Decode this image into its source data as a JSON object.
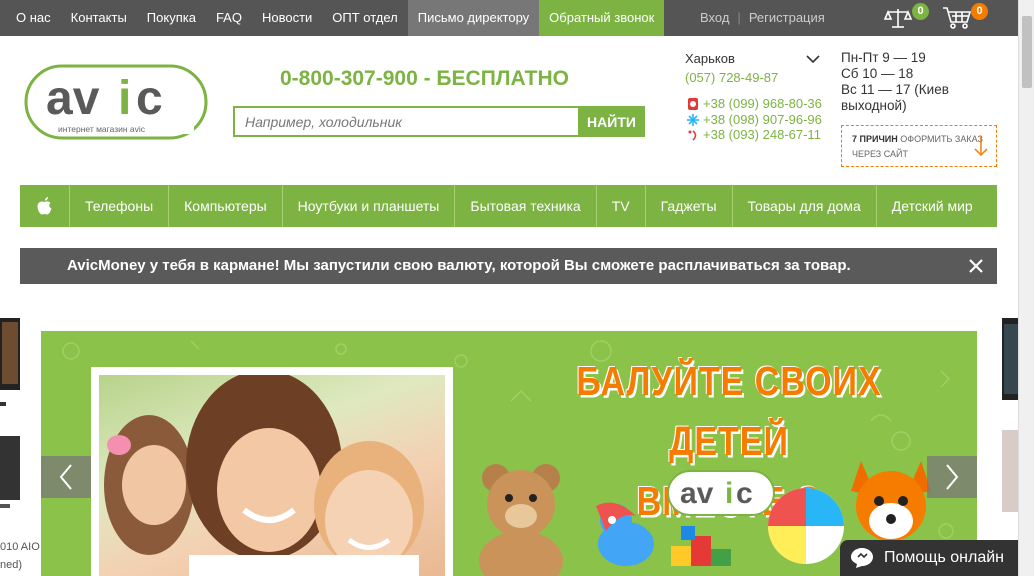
{
  "topbar": {
    "links": [
      "О нас",
      "Контакты",
      "Покупка",
      "FAQ",
      "Новости",
      "ОПТ отдел"
    ],
    "director_label": "Письмо директору",
    "callback_label": "Обратный звонок",
    "login_label": "Вход",
    "auth_separator": "|",
    "register_label": "Регистрация",
    "compare_count": "0",
    "cart_count": "0"
  },
  "header": {
    "logo_text": "avic",
    "logo_subtitle": "интернет магазин avic",
    "main_phone": "0-800-307-900 - БЕСПЛАТНО",
    "search_placeholder": "Например, холодильник",
    "search_button": "НАЙТИ",
    "city": "Харьков",
    "city_phone": "(057) 728-49-87",
    "mobile_phones": [
      "+38 (099) 968-80-36",
      "+38 (098) 907-96-96",
      "+38 (093) 248-67-11"
    ],
    "hours": [
      "Пн-Пт 9 — 19",
      "Сб 10 — 18",
      "Вс 11 — 17 (Киев выходной)"
    ],
    "reasons_bold": "7 причин",
    "reasons_text": "оформить заказ через сайт"
  },
  "nav": {
    "items": [
      "Телефоны",
      "Компьютеры",
      "Ноутбуки и планшеты",
      "Бытовая техника",
      "TV",
      "Гаджеты",
      "Товары для дома",
      "Детский мир"
    ]
  },
  "promo": {
    "text": "AvicMoney у тебя в кармане! Мы запустили свою валюту, которой Вы сможете расплачиваться за товар."
  },
  "slider": {
    "title_line1": "БАЛУЙТЕ СВОИХ ДЕТЕЙ",
    "title_line2": "ВМЕСТЕ С",
    "logo_text": "avic",
    "side_text_1": "010 AIO",
    "side_text_2": "ned)"
  },
  "help": {
    "label": "Помощь онлайн"
  },
  "colors": {
    "brand_green": "#7cb342",
    "accent_orange": "#f57c00",
    "topbar_bg": "#555555",
    "promo_bg": "#5a5a5a"
  }
}
